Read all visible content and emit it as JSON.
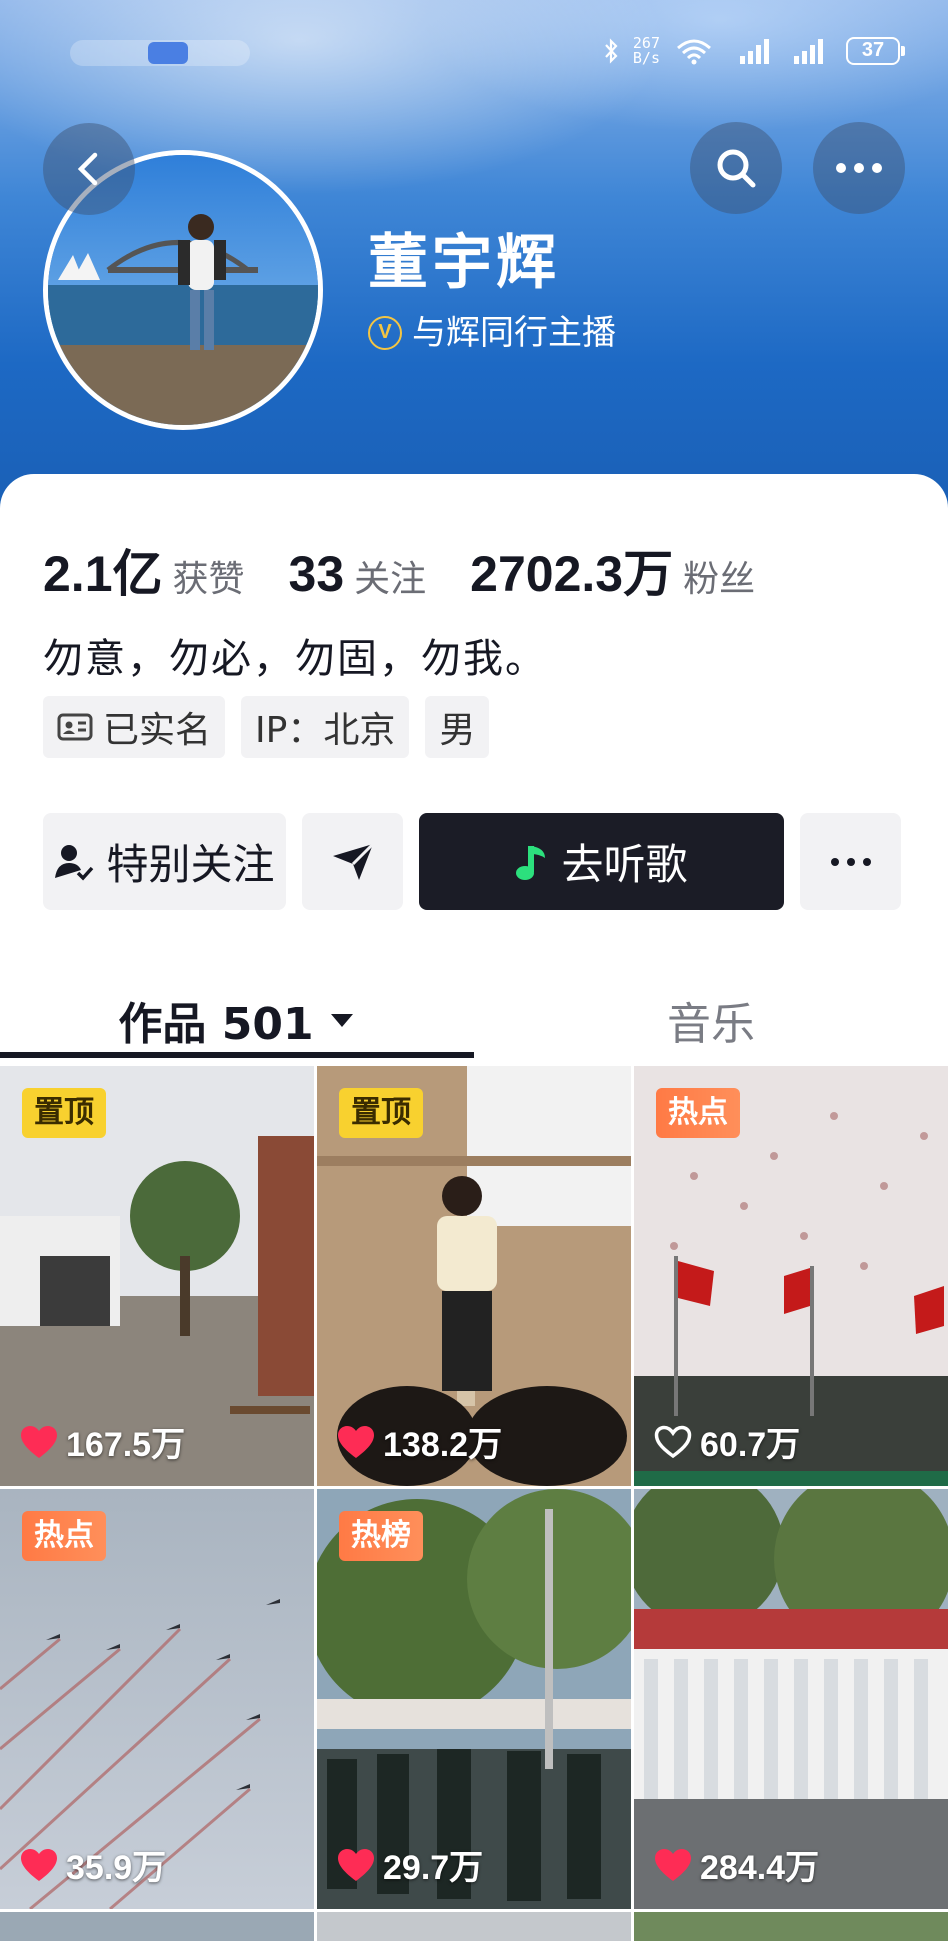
{
  "status_bar": {
    "net_speed_value": "267",
    "net_speed_unit": "B/s",
    "battery": "37"
  },
  "profile": {
    "name": "董宇辉",
    "verified_title": "与辉同行主播",
    "stats": [
      {
        "value": "2.1亿",
        "label": "获赞"
      },
      {
        "value": "33",
        "label": "关注"
      },
      {
        "value": "2702.3万",
        "label": "粉丝"
      }
    ],
    "bio": "勿意，勿必，勿固，勿我。",
    "tags": {
      "real_name": "已实名",
      "ip": "IP：北京",
      "gender": "男"
    }
  },
  "actions": {
    "follow": "特别关注",
    "listen": "去听歌"
  },
  "tabs": {
    "works": "作品 501",
    "music": "音乐"
  },
  "videos": [
    {
      "badge": "置顶",
      "likes": "167.5万"
    },
    {
      "badge": "置顶",
      "likes": "138.2万"
    },
    {
      "badge": "热点",
      "likes": "60.7万"
    },
    {
      "badge": "热点",
      "likes": "35.9万"
    },
    {
      "badge": "热榜",
      "likes": "29.7万"
    },
    {
      "badge": "",
      "likes": "284.4万"
    }
  ],
  "colors": {
    "brand_dark": "#1b1c26",
    "pin_badge": "#f8d12f",
    "hot_badge": "#ff7a45",
    "like_red": "#fe2c55"
  }
}
